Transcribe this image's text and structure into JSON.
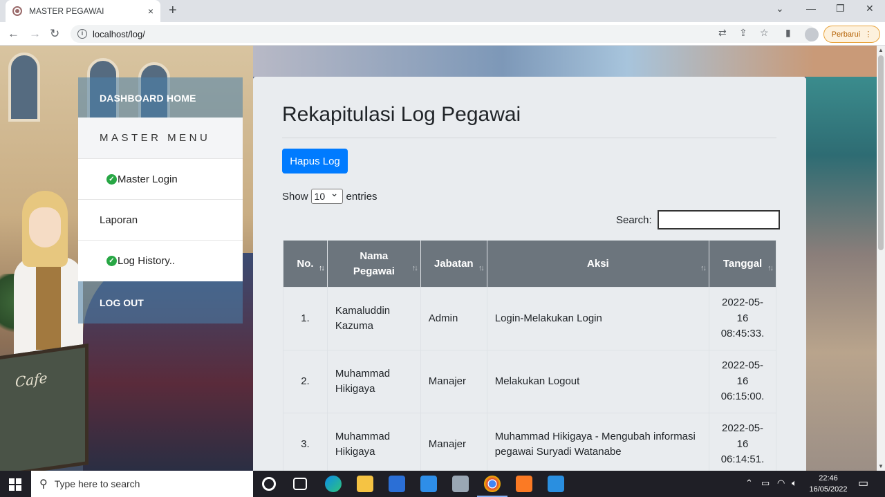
{
  "browser": {
    "tab_title": "MASTER PEGAWAI",
    "tab_close": "×",
    "new_tab": "+",
    "url": "localhost/log/",
    "update_button": "Perbarui"
  },
  "sidebar": {
    "dashboard": "DASHBOARD HOME",
    "menu_heading": "MASTER MENU",
    "items": [
      {
        "label": "Master Login",
        "checked": true
      },
      {
        "label": "Laporan",
        "checked": false
      },
      {
        "label": "Log History..",
        "checked": true
      }
    ],
    "logout": "LOG OUT"
  },
  "main": {
    "title": "Rekapitulasi Log Pegawai",
    "delete_button": "Hapus Log",
    "show_label": "Show",
    "entries_value": "10",
    "entries_label": "entries",
    "search_label": "Search:",
    "search_value": "",
    "table": {
      "headers": [
        "No.",
        "Nama Pegawai",
        "Jabatan",
        "Aksi",
        "Tanggal"
      ],
      "rows": [
        {
          "no": "1.",
          "nama": "Kamaluddin Kazuma",
          "jabatan": "Admin",
          "aksi": "Login-Melakukan Login",
          "tanggal": "2022-05-16 08:45:33."
        },
        {
          "no": "2.",
          "nama": "Muhammad Hikigaya",
          "jabatan": "Manajer",
          "aksi": "Melakukan Logout",
          "tanggal": "2022-05-16 06:15:00."
        },
        {
          "no": "3.",
          "nama": "Muhammad Hikigaya",
          "jabatan": "Manajer",
          "aksi": "Muhammad Hikigaya - Mengubah informasi pegawai Suryadi Watanabe",
          "tanggal": "2022-05-16 06:14:51."
        }
      ]
    }
  },
  "cafe_sign": "Cafe",
  "taskbar": {
    "search_placeholder": "Type here to search",
    "time": "22:46",
    "date": "16/05/2022"
  }
}
